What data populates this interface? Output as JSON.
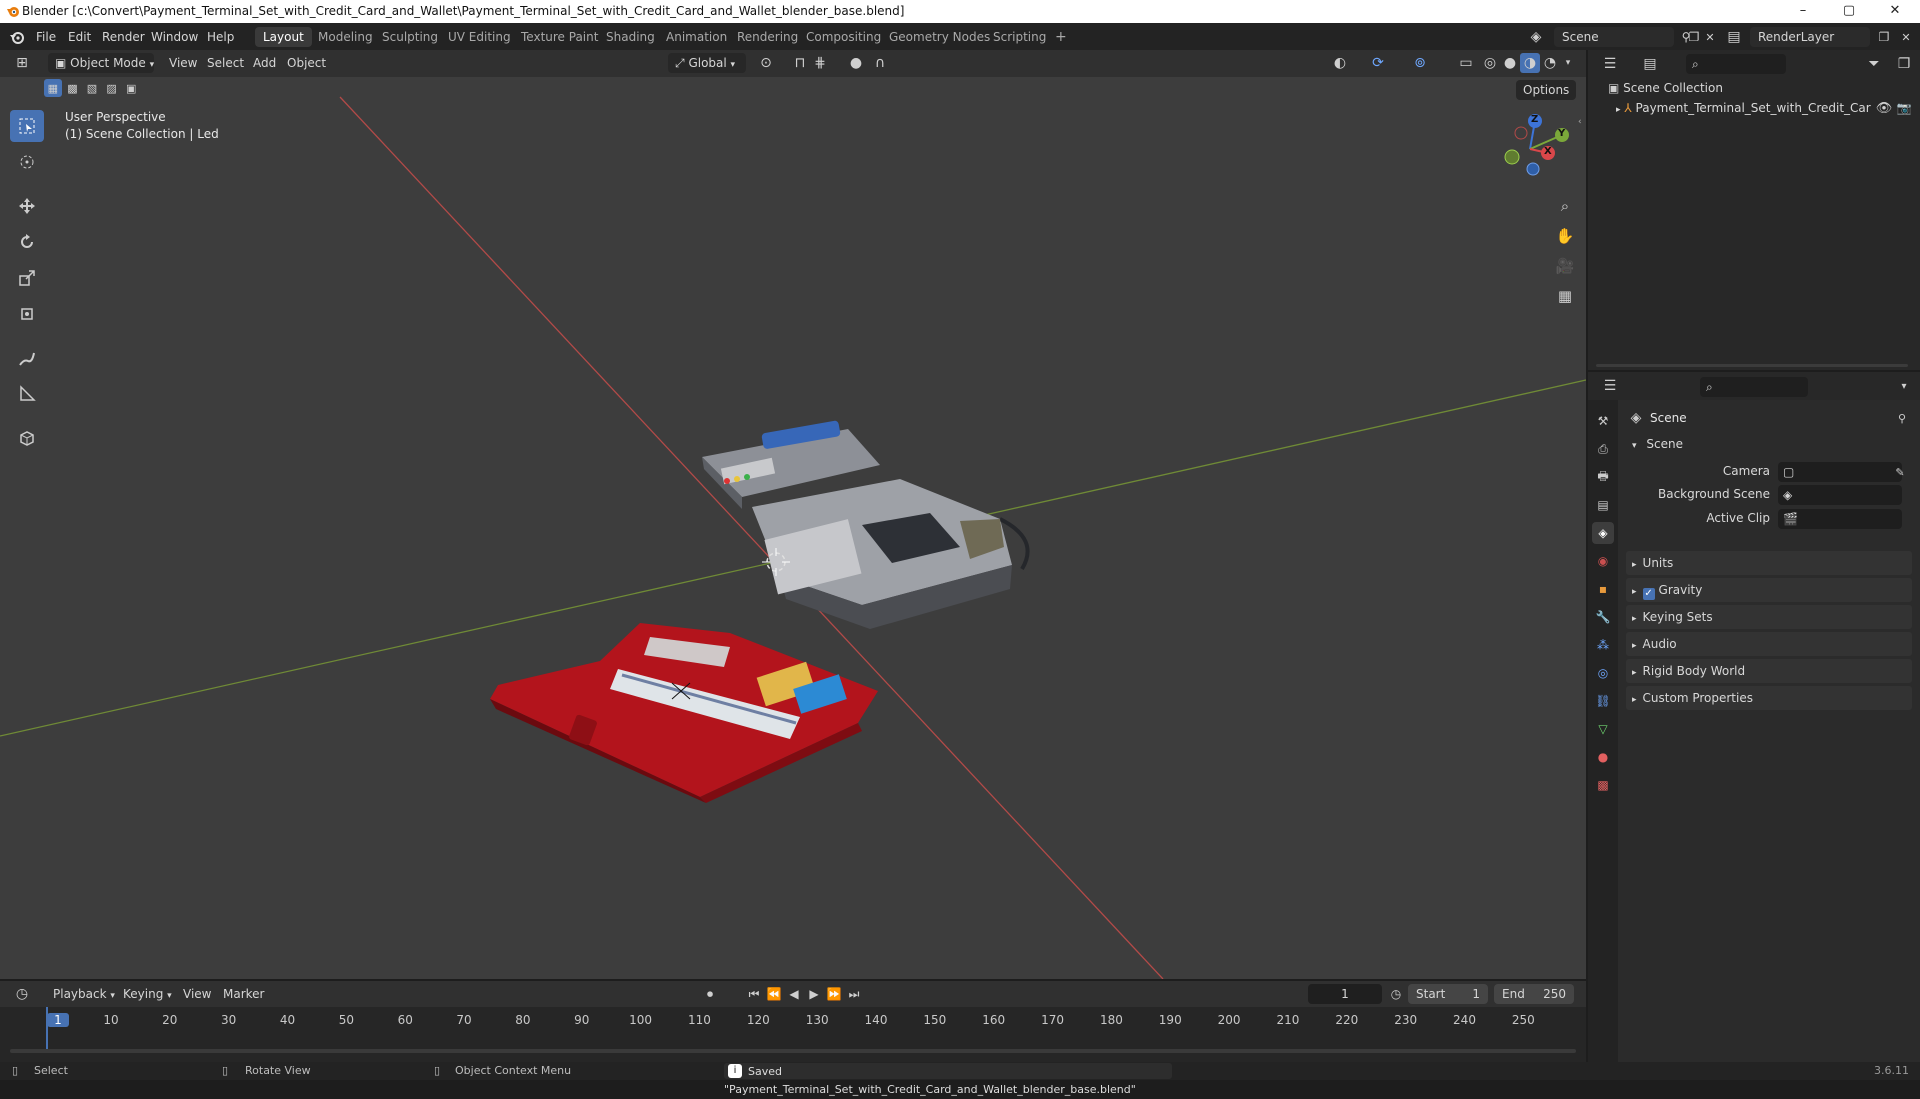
{
  "window": {
    "title": "Blender [c:\\Convert\\Payment_Terminal_Set_with_Credit_Card_and_Wallet\\Payment_Terminal_Set_with_Credit_Card_and_Wallet_blender_base.blend]",
    "minimize": "–",
    "maximize": "▢",
    "close": "✕"
  },
  "menubar": {
    "menus": [
      "File",
      "Edit",
      "Render",
      "Window",
      "Help"
    ],
    "workspaces": [
      "Layout",
      "Modeling",
      "Sculpting",
      "UV Editing",
      "Texture Paint",
      "Shading",
      "Animation",
      "Rendering",
      "Compositing",
      "Geometry Nodes",
      "Scripting"
    ],
    "active_workspace": "Layout",
    "add_workspace": "+",
    "scene": "Scene",
    "view_layer": "RenderLayer"
  },
  "viewport_header": {
    "mode": "Object Mode",
    "menus": [
      "View",
      "Select",
      "Add",
      "Object"
    ],
    "orientation": "Global",
    "options": "Options"
  },
  "viewport": {
    "perspective_label": "User Perspective",
    "collection_label": "(1) Scene Collection | Led",
    "gizmo": {
      "z": "Z",
      "y": "Y",
      "x": "X"
    },
    "colors": {
      "x_axis": "#c4514f",
      "y_axis": "#7a9a3a",
      "background": "#3d3d3d",
      "wallet": "#b3141c"
    }
  },
  "outliner": {
    "root": "Scene Collection",
    "items": [
      "Payment_Terminal_Set_with_Credit_Car"
    ]
  },
  "properties": {
    "header": "Scene",
    "section": "Scene",
    "fields": [
      {
        "label": "Camera",
        "value": ""
      },
      {
        "label": "Background Scene",
        "value": ""
      },
      {
        "label": "Active Clip",
        "value": ""
      }
    ],
    "panels": [
      "Units",
      "Gravity",
      "Keying Sets",
      "Audio",
      "Rigid Body World",
      "Custom Properties"
    ],
    "gravity_checked": true
  },
  "timeline": {
    "menus": [
      "Playback",
      "Keying",
      "View",
      "Marker"
    ],
    "current_frame": "1",
    "start_label": "Start",
    "start": "1",
    "end_label": "End",
    "end": "250",
    "ticks": [
      "1",
      "10",
      "20",
      "30",
      "40",
      "50",
      "60",
      "70",
      "80",
      "90",
      "100",
      "110",
      "120",
      "130",
      "140",
      "150",
      "160",
      "170",
      "180",
      "190",
      "200",
      "210",
      "220",
      "230",
      "240",
      "250"
    ]
  },
  "statusbar": {
    "select": "Select",
    "rotate": "Rotate View",
    "context": "Object Context Menu",
    "message": "Saved \"Payment_Terminal_Set_with_Credit_Card_and_Wallet_blender_base.blend\"",
    "version": "3.6.11"
  }
}
